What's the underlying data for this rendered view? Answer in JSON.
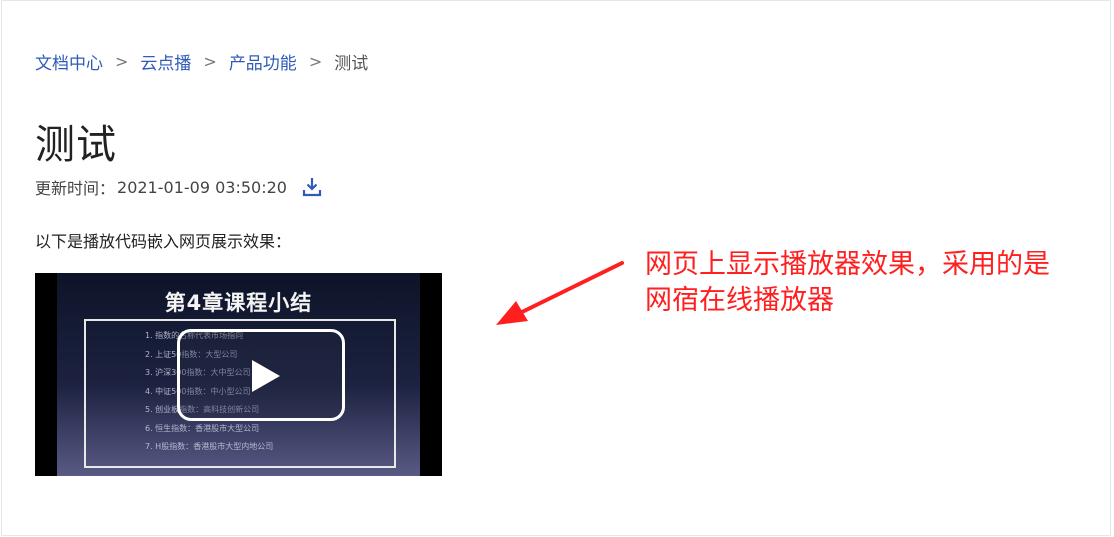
{
  "breadcrumb": {
    "items": [
      "文档中心",
      "云点播",
      "产品功能"
    ],
    "separator": ">",
    "current": "测试"
  },
  "page": {
    "title": "测试",
    "updated_label": "更新时间：",
    "updated_time": "2021-01-09 03:50:20",
    "download_icon": "download-icon",
    "intro": "以下是播放代码嵌入网页展示效果："
  },
  "video": {
    "slide_title": "第4章课程小结",
    "slide_lines": [
      "1. 指数的名称代表市场指向",
      "2. 上证50指数：大型公司",
      "3. 沪深300指数：大中型公司",
      "4. 中证500指数：中小型公司",
      "5. 创业板指数：高科技创新公司",
      "6. 恒生指数：香港股市大型公司",
      "7. H股指数：香港股市大型内地公司"
    ],
    "play_icon": "play-icon"
  },
  "annotation": {
    "text_line1": "网页上显示播放器效果，采用的是",
    "text_line2": "网宿在线播放器",
    "color": "#ff1f1f"
  },
  "colors": {
    "link": "#2f5bb8",
    "annotation": "#ff1f1f"
  }
}
